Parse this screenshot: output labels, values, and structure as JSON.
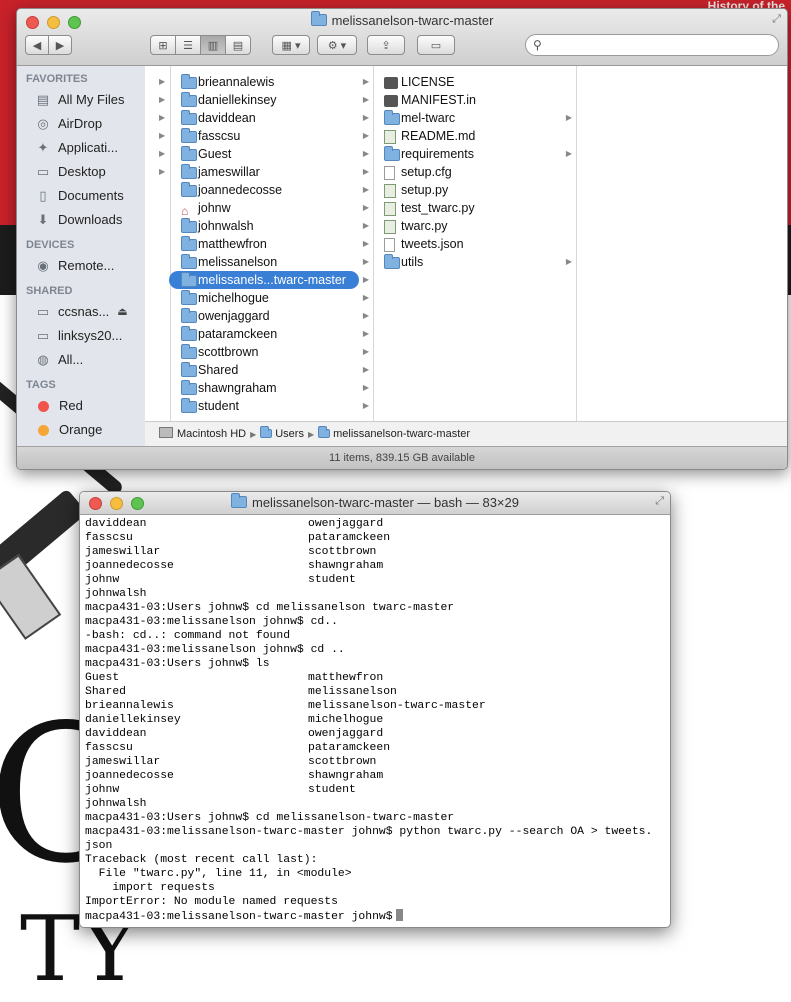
{
  "wallpaper": {
    "top_right_text": "History of the",
    "big_letter": "O",
    "bottom_letters": "TY"
  },
  "finder": {
    "window_title": "melissanelson-twarc-master",
    "toolbar": {
      "back_icon": "chevron-left-icon",
      "forward_icon": "chevron-right-icon",
      "search_placeholder": ""
    },
    "sidebar": {
      "favorites_header": "FAVORITES",
      "favorites": [
        {
          "label": "All My Files",
          "icon": "all-files-icon"
        },
        {
          "label": "AirDrop",
          "icon": "airdrop-icon"
        },
        {
          "label": "Applicati...",
          "icon": "applications-icon"
        },
        {
          "label": "Desktop",
          "icon": "desktop-icon"
        },
        {
          "label": "Documents",
          "icon": "documents-icon"
        },
        {
          "label": "Downloads",
          "icon": "downloads-icon"
        }
      ],
      "devices_header": "DEVICES",
      "devices": [
        {
          "label": "Remote...",
          "icon": "disc-icon"
        }
      ],
      "shared_header": "SHARED",
      "shared": [
        {
          "label": "ccsnas...",
          "icon": "computer-icon"
        },
        {
          "label": "linksys20...",
          "icon": "computer-icon"
        },
        {
          "label": "All...",
          "icon": "network-icon"
        }
      ],
      "tags_header": "TAGS",
      "tags": [
        {
          "label": "Red",
          "color": "#f0544b"
        },
        {
          "label": "Orange",
          "color": "#f6a637"
        }
      ]
    },
    "users_column": [
      "brieannalewis",
      "daniellekinsey",
      "daviddean",
      "fasscsu",
      "Guest",
      "jameswillar",
      "joannedecosse",
      "johnw",
      "johnwalsh",
      "matthewfron",
      "melissanelson",
      "melissanels...twarc-master",
      "michelhogue",
      "owenjaggard",
      "pataramckeen",
      "scottbrown",
      "Shared",
      "shawngraham",
      "student"
    ],
    "selected_user": "melissanels...twarc-master",
    "files_column": [
      {
        "name": "LICENSE",
        "kind": "dark-doc"
      },
      {
        "name": "MANIFEST.in",
        "kind": "dark-doc"
      },
      {
        "name": "mel-twarc",
        "kind": "folder"
      },
      {
        "name": "README.md",
        "kind": "script"
      },
      {
        "name": "requirements",
        "kind": "folder"
      },
      {
        "name": "setup.cfg",
        "kind": "doc"
      },
      {
        "name": "setup.py",
        "kind": "script"
      },
      {
        "name": "test_twarc.py",
        "kind": "script"
      },
      {
        "name": "twarc.py",
        "kind": "script"
      },
      {
        "name": "tweets.json",
        "kind": "doc"
      },
      {
        "name": "utils",
        "kind": "folder"
      }
    ],
    "path_bar": [
      "Macintosh HD",
      "Users",
      "melissanelson-twarc-master"
    ],
    "status": "11 items, 839.15 GB available"
  },
  "terminal": {
    "window_title": "melissanelson-twarc-master — bash — 83×29",
    "lines": [
      [
        "daviddean",
        "owenjaggard"
      ],
      [
        "fasscsu",
        "pataramckeen"
      ],
      [
        "jameswillar",
        "scottbrown"
      ],
      [
        "joannedecosse",
        "shawngraham"
      ],
      [
        "johnw",
        "student"
      ],
      [
        "johnwalsh"
      ],
      [
        "macpa431-03:Users johnw$ cd melissanelson twarc-master"
      ],
      [
        "macpa431-03:melissanelson johnw$ cd.."
      ],
      [
        "-bash: cd..: command not found"
      ],
      [
        "macpa431-03:melissanelson johnw$ cd .."
      ],
      [
        "macpa431-03:Users johnw$ ls"
      ],
      [
        "Guest",
        "matthewfron"
      ],
      [
        "Shared",
        "melissanelson"
      ],
      [
        "brieannalewis",
        "melissanelson-twarc-master"
      ],
      [
        "daniellekinsey",
        "michelhogue"
      ],
      [
        "daviddean",
        "owenjaggard"
      ],
      [
        "fasscsu",
        "pataramckeen"
      ],
      [
        "jameswillar",
        "scottbrown"
      ],
      [
        "joannedecosse",
        "shawngraham"
      ],
      [
        "johnw",
        "student"
      ],
      [
        "johnwalsh"
      ],
      [
        "macpa431-03:Users johnw$ cd melissanelson-twarc-master"
      ],
      [
        "macpa431-03:melissanelson-twarc-master johnw$ python twarc.py --search OA > tweets."
      ],
      [
        "json"
      ],
      [
        "Traceback (most recent call last):"
      ],
      [
        "  File \"twarc.py\", line 11, in <module>"
      ],
      [
        "    import requests"
      ],
      [
        "ImportError: No module named requests"
      ]
    ],
    "prompt": "macpa431-03:melissanelson-twarc-master johnw$"
  }
}
